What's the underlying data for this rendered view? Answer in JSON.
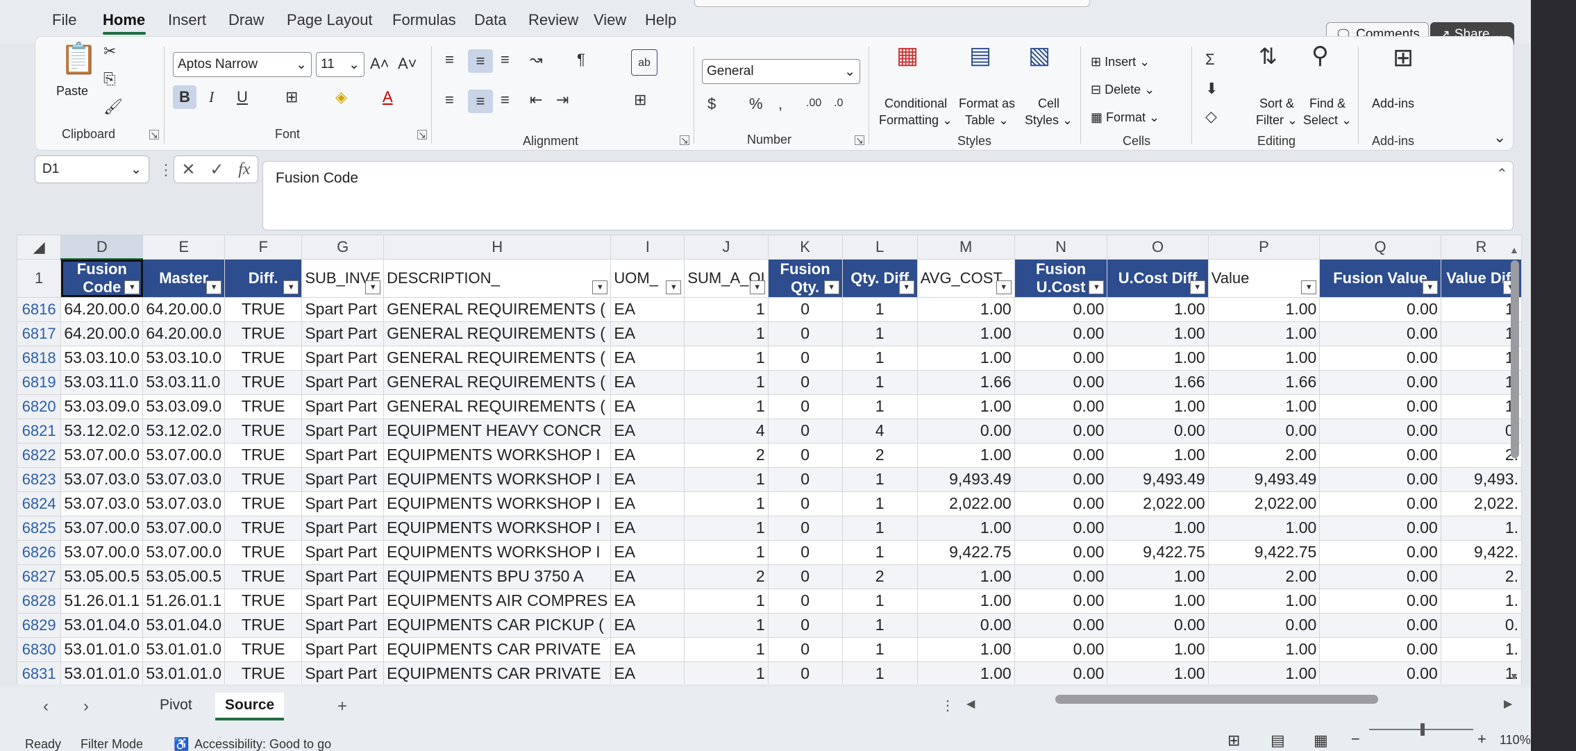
{
  "menu": {
    "items": [
      "File",
      "Home",
      "Insert",
      "Draw",
      "Page Layout",
      "Formulas",
      "Data",
      "Review",
      "View",
      "Help"
    ],
    "comments_label": "Comments",
    "share_label": "Share"
  },
  "ribbon": {
    "clipboard": {
      "paste": "Paste",
      "group": "Clipboard"
    },
    "font": {
      "family": "Aptos Narrow",
      "size": "11",
      "group": "Font"
    },
    "alignment": {
      "group": "Alignment"
    },
    "number": {
      "format": "General",
      "group": "Number"
    },
    "styles": {
      "conditional": "Conditional",
      "conditional2": "Formatting",
      "format_table": "Format as",
      "format_table2": "Table",
      "cell_styles": "Cell",
      "cell_styles2": "Styles",
      "group": "Styles"
    },
    "cells": {
      "insert": "Insert",
      "delete": "Delete",
      "format": "Format",
      "group": "Cells"
    },
    "editing": {
      "sort": "Sort &",
      "sort2": "Filter",
      "find": "Find &",
      "find2": "Select",
      "group": "Editing"
    },
    "addins": {
      "label": "Add-ins",
      "group": "Add-ins"
    }
  },
  "formula_bar": {
    "name_box": "D1",
    "formula": "Fusion Code"
  },
  "columns": [
    "D",
    "E",
    "F",
    "G",
    "H",
    "I",
    "J",
    "K",
    "L",
    "M",
    "N",
    "O",
    "P",
    "Q",
    "R"
  ],
  "header_row": {
    "row_number": "1",
    "cells": [
      {
        "text": "Fusion Code",
        "line1": "Fusion",
        "line2": "Code",
        "style": "blue"
      },
      {
        "text": "Master",
        "line1": "Master",
        "line2": "",
        "style": "blue"
      },
      {
        "text": "Diff.",
        "line1": "Diff.",
        "line2": "",
        "style": "blue"
      },
      {
        "text": "SUB_INVE",
        "line1": "SUB_INVE",
        "line2": "",
        "style": "plain"
      },
      {
        "text": "DESCRIPTION_",
        "line1": "DESCRIPTION_",
        "line2": "",
        "style": "plain"
      },
      {
        "text": "UOM_",
        "line1": "UOM_",
        "line2": "",
        "style": "plain"
      },
      {
        "text": "SUM_A_OI",
        "line1": "SUM_A_OI",
        "line2": "",
        "style": "plain"
      },
      {
        "text": "Fusion Qty.",
        "line1": "Fusion",
        "line2": "Qty.",
        "style": "blue"
      },
      {
        "text": "Qty. Diff",
        "line1": "Qty. Diff",
        "line2": "",
        "style": "blue"
      },
      {
        "text": "AVG_COST",
        "line1": "AVG_COST_",
        "line2": "",
        "style": "plain"
      },
      {
        "text": "Fusion U.Cost",
        "line1": "Fusion",
        "line2": "U.Cost",
        "style": "blue"
      },
      {
        "text": "U.Cost Diff",
        "line1": "U.Cost Diff",
        "line2": "",
        "style": "blue"
      },
      {
        "text": "Value",
        "line1": "Value",
        "line2": "",
        "style": "plain"
      },
      {
        "text": "Fusion Value",
        "line1": "Fusion Value",
        "line2": "",
        "style": "blue"
      },
      {
        "text": "Value Diff",
        "line1": "Value Diff",
        "line2": "",
        "style": "blue"
      }
    ]
  },
  "rows": [
    {
      "n": "6816",
      "c": [
        "64.20.00.0",
        "64.20.00.0",
        "TRUE",
        "Spart Part",
        "GENERAL REQUIREMENTS (",
        "EA",
        "1",
        "0",
        "1",
        "1.00",
        "0.00",
        "1.00",
        "1.00",
        "0.00",
        "1."
      ]
    },
    {
      "n": "6817",
      "c": [
        "64.20.00.0",
        "64.20.00.0",
        "TRUE",
        "Spart Part",
        "GENERAL REQUIREMENTS (",
        "EA",
        "1",
        "0",
        "1",
        "1.00",
        "0.00",
        "1.00",
        "1.00",
        "0.00",
        "1."
      ]
    },
    {
      "n": "6818",
      "c": [
        "53.03.10.0",
        "53.03.10.0",
        "TRUE",
        "Spart Part",
        "GENERAL REQUIREMENTS (",
        "EA",
        "1",
        "0",
        "1",
        "1.00",
        "0.00",
        "1.00",
        "1.00",
        "0.00",
        "1."
      ]
    },
    {
      "n": "6819",
      "c": [
        "53.03.11.0",
        "53.03.11.0",
        "TRUE",
        "Spart Part",
        "GENERAL REQUIREMENTS (",
        "EA",
        "1",
        "0",
        "1",
        "1.66",
        "0.00",
        "1.66",
        "1.66",
        "0.00",
        "1."
      ]
    },
    {
      "n": "6820",
      "c": [
        "53.03.09.0",
        "53.03.09.0",
        "TRUE",
        "Spart Part",
        "GENERAL REQUIREMENTS (",
        "EA",
        "1",
        "0",
        "1",
        "1.00",
        "0.00",
        "1.00",
        "1.00",
        "0.00",
        "1."
      ]
    },
    {
      "n": "6821",
      "c": [
        "53.12.02.0",
        "53.12.02.0",
        "TRUE",
        "Spart Part",
        "EQUIPMENT HEAVY CONCR",
        "EA",
        "4",
        "0",
        "4",
        "0.00",
        "0.00",
        "0.00",
        "0.00",
        "0.00",
        "0."
      ]
    },
    {
      "n": "6822",
      "c": [
        "53.07.00.0",
        "53.07.00.0",
        "TRUE",
        "Spart Part",
        "EQUIPMENTS  WORKSHOP I",
        "EA",
        "2",
        "0",
        "2",
        "1.00",
        "0.00",
        "1.00",
        "2.00",
        "0.00",
        "2."
      ]
    },
    {
      "n": "6823",
      "c": [
        "53.07.03.0",
        "53.07.03.0",
        "TRUE",
        "Spart Part",
        "EQUIPMENTS  WORKSHOP I",
        "EA",
        "1",
        "0",
        "1",
        "9,493.49",
        "0.00",
        "9,493.49",
        "9,493.49",
        "0.00",
        "9,493."
      ]
    },
    {
      "n": "6824",
      "c": [
        "53.07.03.0",
        "53.07.03.0",
        "TRUE",
        "Spart Part",
        "EQUIPMENTS  WORKSHOP I",
        "EA",
        "1",
        "0",
        "1",
        "2,022.00",
        "0.00",
        "2,022.00",
        "2,022.00",
        "0.00",
        "2,022."
      ]
    },
    {
      "n": "6825",
      "c": [
        "53.07.00.0",
        "53.07.00.0",
        "TRUE",
        "Spart Part",
        "EQUIPMENTS  WORKSHOP I",
        "EA",
        "1",
        "0",
        "1",
        "1.00",
        "0.00",
        "1.00",
        "1.00",
        "0.00",
        "1."
      ]
    },
    {
      "n": "6826",
      "c": [
        "53.07.00.0",
        "53.07.00.0",
        "TRUE",
        "Spart Part",
        "EQUIPMENTS  WORKSHOP I",
        "EA",
        "1",
        "0",
        "1",
        "9,422.75",
        "0.00",
        "9,422.75",
        "9,422.75",
        "0.00",
        "9,422."
      ]
    },
    {
      "n": "6827",
      "c": [
        "53.05.00.5",
        "53.05.00.5",
        "TRUE",
        "Spart Part",
        "EQUIPMENTS  BPU 3750 A",
        "EA",
        "2",
        "0",
        "2",
        "1.00",
        "0.00",
        "1.00",
        "2.00",
        "0.00",
        "2."
      ]
    },
    {
      "n": "6828",
      "c": [
        "51.26.01.1",
        "51.26.01.1",
        "TRUE",
        "Spart Part",
        "EQUIPMENTS AIR COMPRES",
        "EA",
        "1",
        "0",
        "1",
        "1.00",
        "0.00",
        "1.00",
        "1.00",
        "0.00",
        "1."
      ]
    },
    {
      "n": "6829",
      "c": [
        "53.01.04.0",
        "53.01.04.0",
        "TRUE",
        "Spart Part",
        "EQUIPMENTS CAR PICKUP (",
        "EA",
        "1",
        "0",
        "1",
        "0.00",
        "0.00",
        "0.00",
        "0.00",
        "0.00",
        "0."
      ]
    },
    {
      "n": "6830",
      "c": [
        "53.01.01.0",
        "53.01.01.0",
        "TRUE",
        "Spart Part",
        "EQUIPMENTS CAR PRIVATE",
        "EA",
        "1",
        "0",
        "1",
        "1.00",
        "0.00",
        "1.00",
        "1.00",
        "0.00",
        "1."
      ]
    },
    {
      "n": "6831",
      "c": [
        "53.01.01.0",
        "53.01.01.0",
        "TRUE",
        "Spart Part",
        "EQUIPMENTS CAR PRIVATE",
        "EA",
        "1",
        "0",
        "1",
        "1.00",
        "0.00",
        "1.00",
        "1.00",
        "0.00",
        "1."
      ]
    }
  ],
  "sheets": [
    {
      "name": "Pivot",
      "active": false
    },
    {
      "name": "Source",
      "active": true
    }
  ],
  "status": {
    "ready": "Ready",
    "mode": "Filter Mode",
    "accessibility": "Accessibility: Good to go",
    "zoom": "110%"
  }
}
